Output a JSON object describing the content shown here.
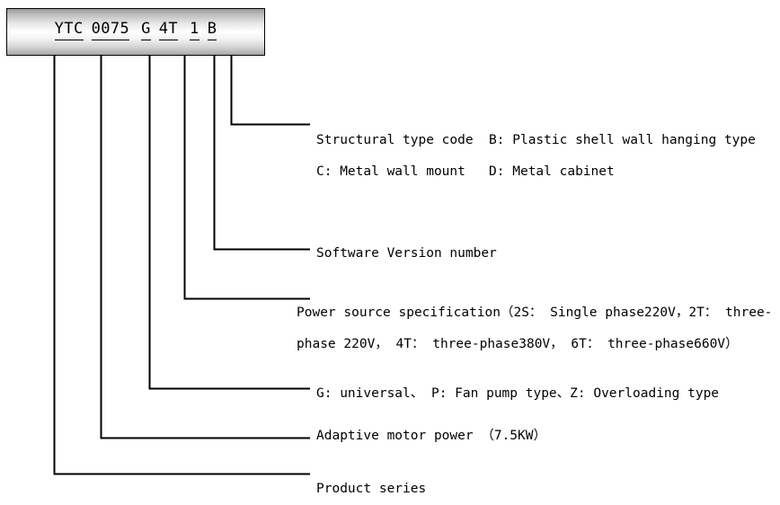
{
  "model_code": {
    "full": "YTC 0075 G 4T 1 B",
    "segments": [
      {
        "text": "YTC",
        "meaning": "Product series"
      },
      {
        "text": "0075",
        "meaning": "Adaptive motor power (7.5KW)"
      },
      {
        "text": "G",
        "meaning": "G: universal, P: Fan pump type, Z: Overloading type"
      },
      {
        "text": "4T",
        "meaning": "Power source specification"
      },
      {
        "text": "1",
        "meaning": "Software Version number"
      },
      {
        "text": "B",
        "meaning": "Structural type code"
      }
    ]
  },
  "descriptions": {
    "structural": "Structural type code  B: Plastic shell wall hanging type   C: Metal wall mount   D: Metal cabinet",
    "software": "Software Version number",
    "power": "Power source specification（2S： Single phase220V，2T： three-phase 220V， 4T： three-phase380V， 6T： three-phase660V）",
    "load_type": "G: universal、 P: Fan pump type、Z: Overloading type",
    "motor_power": "Adaptive motor power （7.5KW）",
    "product_series": "Product series"
  },
  "colors": {
    "line": "#000000",
    "text": "#000000",
    "box_border": "#000000",
    "background": "#ffffff"
  }
}
